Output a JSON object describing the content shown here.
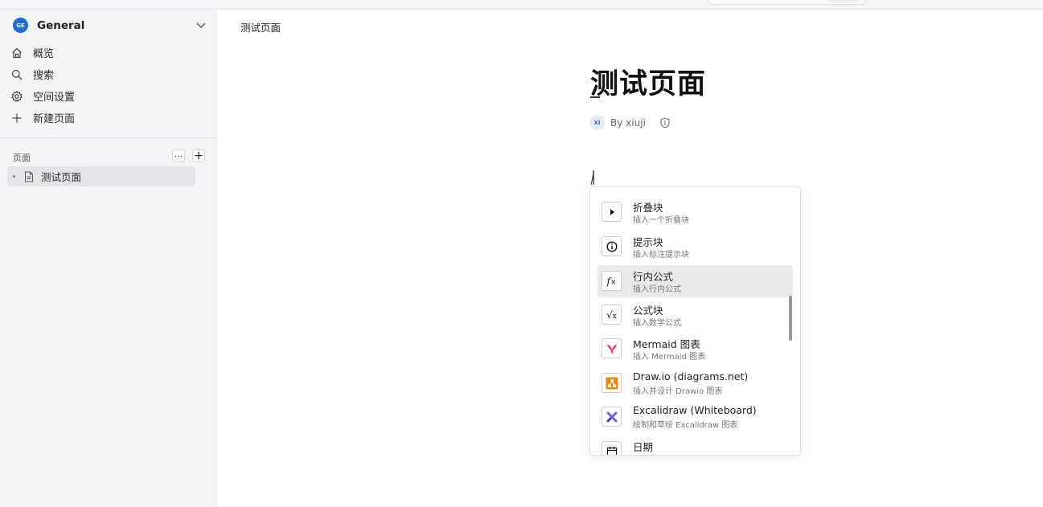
{
  "workspace": {
    "badge": "GE",
    "name": "General"
  },
  "nav": [
    {
      "label": "概览",
      "icon": "home-icon"
    },
    {
      "label": "搜索",
      "icon": "search-icon"
    },
    {
      "label": "空间设置",
      "icon": "gear-icon"
    },
    {
      "label": "新建页面",
      "icon": "plus-icon"
    }
  ],
  "pages": {
    "label": "页面",
    "more_button": "···",
    "add_button": "+",
    "items": [
      {
        "label": "测试页面",
        "icon": "document-icon"
      }
    ]
  },
  "breadcrumb": "测试页面",
  "doc": {
    "title": "测试页面",
    "author_badge": "XI",
    "author_text": "By xiuji",
    "input_text": "/"
  },
  "slash_menu": {
    "items": [
      {
        "title": "折叠块",
        "desc": "插入一个折叠块",
        "icon": "triangle-right-icon"
      },
      {
        "title": "提示块",
        "desc": "插入标注提示块",
        "icon": "info-icon"
      },
      {
        "title": "行内公式",
        "desc": "插入行内公式",
        "icon": "fx-icon",
        "active": true
      },
      {
        "title": "公式块",
        "desc": "插入数学公式",
        "icon": "sqrt-icon"
      },
      {
        "title": "Mermaid 图表",
        "desc": "插入 Mermaid 图表",
        "icon": "mermaid-icon"
      },
      {
        "title": "Draw.io (diagrams.net)",
        "desc": "插入并设计 Drawio 图表",
        "icon": "drawio-icon"
      },
      {
        "title": "Excalidraw (Whiteboard)",
        "desc": "绘制和草绘 Excalidraw 图表",
        "icon": "excalidraw-icon"
      },
      {
        "title": "日期",
        "desc": "",
        "icon": "calendar-icon"
      }
    ]
  },
  "colors": {
    "accent": "#1c6cd9",
    "mermaid": "#ff3670",
    "drawio": "#f08705",
    "excalidraw": "#6965db"
  }
}
